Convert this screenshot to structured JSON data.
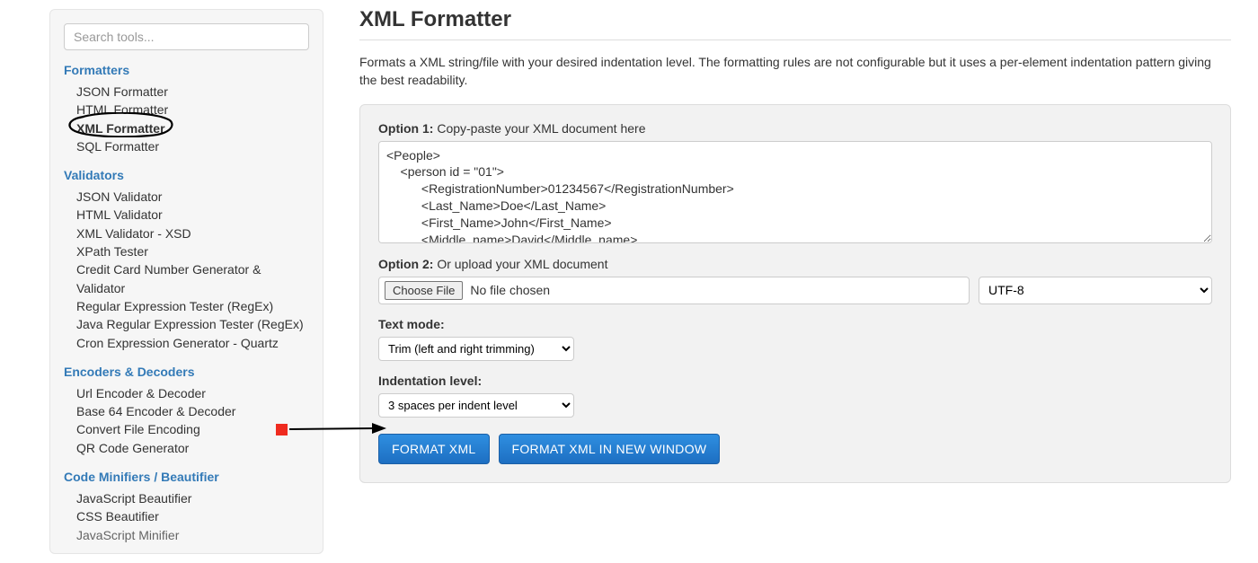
{
  "sidebar": {
    "search_placeholder": "Search tools...",
    "categories": [
      {
        "title": "Formatters",
        "items": [
          "JSON Formatter",
          "HTML Formatter",
          "XML Formatter",
          "SQL Formatter"
        ]
      },
      {
        "title": "Validators",
        "items": [
          "JSON Validator",
          "HTML Validator",
          "XML Validator - XSD",
          "XPath Tester",
          "Credit Card Number Generator & Validator",
          "Regular Expression Tester (RegEx)",
          "Java Regular Expression Tester (RegEx)",
          "Cron Expression Generator - Quartz"
        ]
      },
      {
        "title": "Encoders & Decoders",
        "items": [
          "Url Encoder & Decoder",
          "Base 64 Encoder & Decoder",
          "Convert File Encoding",
          "QR Code Generator"
        ]
      },
      {
        "title": "Code Minifiers / Beautifier",
        "items": [
          "JavaScript Beautifier",
          "CSS Beautifier",
          "JavaScript Minifier"
        ]
      }
    ]
  },
  "main": {
    "title": "XML Formatter",
    "description": "Formats a XML string/file with your desired indentation level. The formatting rules are not configurable but it uses a per-element indentation pattern giving the best readability.",
    "option1_label_bold": "Option 1:",
    "option1_label_rest": " Copy-paste your XML document here",
    "xml_value": "<People>\n    <person id = \"01\">\n          <RegistrationNumber>01234567</RegistrationNumber>\n          <Last_Name>Doe</Last_Name>\n          <First_Name>John</First_Name>\n          <Middle_name>David</Middle_name>",
    "option2_label_bold": "Option 2:",
    "option2_label_rest": " Or upload your XML document",
    "choose_file_label": "Choose File",
    "no_file_text": "No file chosen",
    "encoding_value": "UTF-8",
    "text_mode_label": "Text mode:",
    "text_mode_value": "Trim (left and right trimming)",
    "indent_label": "Indentation level:",
    "indent_value": "3 spaces per indent level",
    "btn_format": "FORMAT XML",
    "btn_format_new": "FORMAT XML IN NEW WINDOW"
  }
}
